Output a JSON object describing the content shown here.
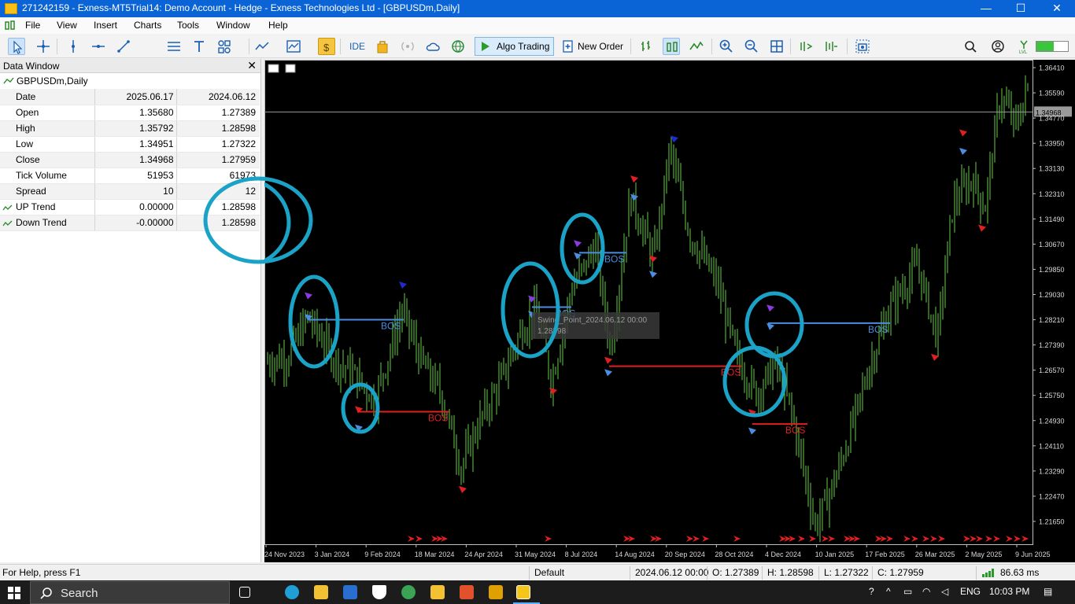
{
  "window": {
    "title": "271242159 - Exness-MT5Trial14: Demo Account - Hedge - Exness Technologies Ltd - [GBPUSDm,Daily]",
    "minimize": "—",
    "maximize": "☐",
    "close": "✕"
  },
  "menu": [
    "File",
    "View",
    "Insert",
    "Charts",
    "Tools",
    "Window",
    "Help"
  ],
  "toolbar": {
    "ide": "IDE",
    "algo_trading": "Algo Trading",
    "new_order": "New Order"
  },
  "data_window": {
    "title": "Data Window",
    "symbol": "GBPUSDm,Daily",
    "rows": [
      {
        "label": "Date",
        "v1": "2025.06.17",
        "v2": "2024.06.12"
      },
      {
        "label": "Open",
        "v1": "1.35680",
        "v2": "1.27389"
      },
      {
        "label": "High",
        "v1": "1.35792",
        "v2": "1.28598"
      },
      {
        "label": "Low",
        "v1": "1.34951",
        "v2": "1.27322"
      },
      {
        "label": "Close",
        "v1": "1.34968",
        "v2": "1.27959"
      },
      {
        "label": "Tick Volume",
        "v1": "51953",
        "v2": "61973"
      },
      {
        "label": "Spread",
        "v1": "10",
        "v2": "12"
      },
      {
        "label": "UP Trend",
        "v1": "0.00000",
        "v2": "1.28598",
        "icon": "indicator-icon"
      },
      {
        "label": "Down Trend",
        "v1": "-0.00000",
        "v2": "1.28598",
        "icon": "indicator-icon"
      }
    ]
  },
  "chart": {
    "symbol": "GBPUSDm",
    "timeframe": "Daily",
    "bid_line_label": "1.34968",
    "price_ticks": [
      "1.36410",
      "1.35590",
      "1.34770",
      "1.33950",
      "1.33130",
      "1.32310",
      "1.31490",
      "1.30670",
      "1.29850",
      "1.29030",
      "1.28210",
      "1.27390",
      "1.26570",
      "1.25750",
      "1.24930",
      "1.24110",
      "1.23290",
      "1.22470",
      "1.21650"
    ],
    "date_ticks": [
      "24 Nov 2023",
      "3 Jan 2024",
      "9 Feb 2024",
      "18 Mar 2024",
      "24 Apr 2024",
      "31 May 2024",
      "8 Jul 2024",
      "14 Aug 2024",
      "20 Sep 2024",
      "28 Oct 2024",
      "4 Dec 2024",
      "10 Jan 2025",
      "17 Feb 2025",
      "26 Mar 2025",
      "2 May 2025",
      "9 Jun 2025"
    ],
    "bos_label": "BOS",
    "tooltip_line1": "Swing_Point_2024.06.12 00:00",
    "tooltip_line2": "1.28598",
    "colors": {
      "up": "#4b8de0",
      "down": "#e02020",
      "candle": "#66cc44",
      "background": "#000000",
      "annotation": "#1aa3c6"
    }
  },
  "status": {
    "help": "For Help, press F1",
    "profile": "Default",
    "datetime": "2024.06.12 00:00",
    "open": "O: 1.27389",
    "high": "H: 1.28598",
    "low": "L: 1.27322",
    "close": "C: 1.27959",
    "ping": "86.63 ms"
  },
  "taskbar": {
    "search": "Search",
    "lang": "ENG",
    "time": "10:03 PM"
  }
}
